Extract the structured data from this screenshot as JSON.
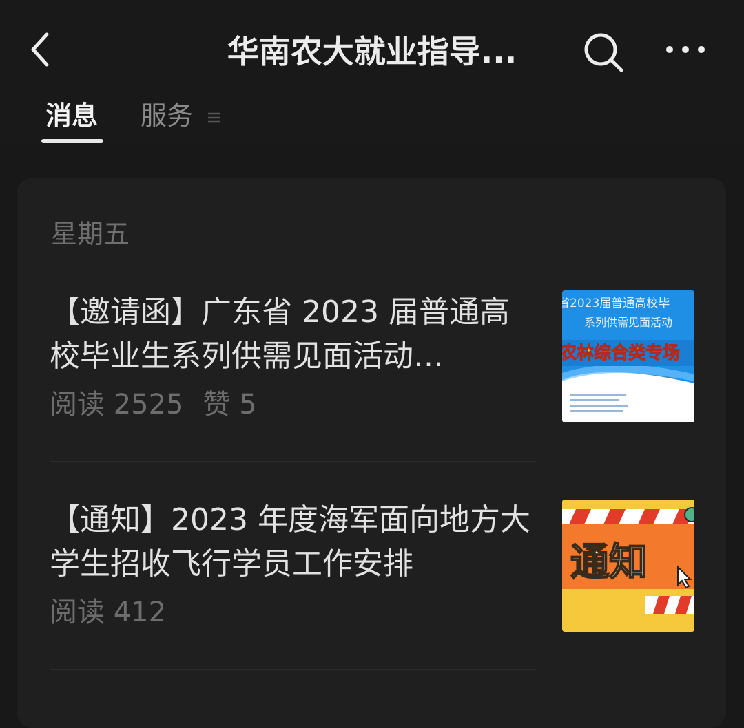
{
  "header": {
    "title": "华南农大就业指导...",
    "back_icon": "back-arrow-icon",
    "search_icon": "search-icon",
    "more_icon": "more-dots-icon"
  },
  "tabs": [
    {
      "label": "消息",
      "active": true
    },
    {
      "label": "服务",
      "active": false,
      "icon": "menu-lines-icon"
    }
  ],
  "feed": {
    "date": "星期五",
    "articles": [
      {
        "title": "【邀请函】广东省 2023 届普通高校毕业生系列供需见面活动…",
        "reads": "阅读 2525",
        "likes": "赞 5",
        "thumbnail": {
          "line1": "省2023届普通高校毕",
          "line2": "系列供需见面活动",
          "banner": "农林综合类专场"
        }
      },
      {
        "title": "【通知】2023 年度海军面向地方大学生招收飞行学员工作安排",
        "reads": "阅读 412",
        "thumbnail": {
          "banner": "通知"
        }
      }
    ]
  },
  "colors": {
    "background": "#181818",
    "card": "#1f1f1f",
    "thumb_blue": "#1f8fe5",
    "thumb_orange": "#f37a2c"
  }
}
